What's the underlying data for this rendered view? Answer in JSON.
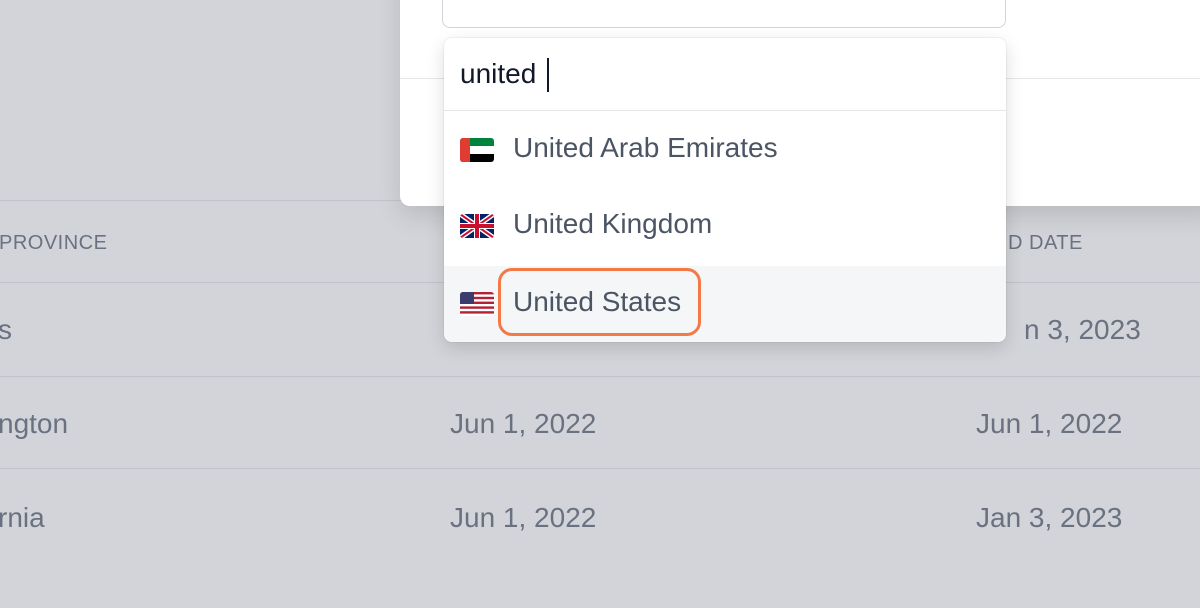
{
  "table": {
    "headers": [
      "PROVINCE",
      "D DATE"
    ],
    "rows": [
      {
        "region": "s",
        "created": "",
        "updated": "n 3, 2023"
      },
      {
        "region": "ngton",
        "created": "Jun 1, 2022",
        "updated": "Jun 1, 2022"
      },
      {
        "region": "rnia",
        "created": "Jun 1, 2022",
        "updated": "Jan 3, 2023"
      }
    ]
  },
  "dropdown": {
    "search_value": "united",
    "options": [
      {
        "label": "United Arab Emirates",
        "flag": "uae-flag-icon"
      },
      {
        "label": "United Kingdom",
        "flag": "uk-flag-icon"
      },
      {
        "label": "United States",
        "flag": "us-flag-icon",
        "highlighted": true
      }
    ]
  },
  "colors": {
    "highlight_ring": "#f47a45",
    "overlay": "#6b7280"
  }
}
